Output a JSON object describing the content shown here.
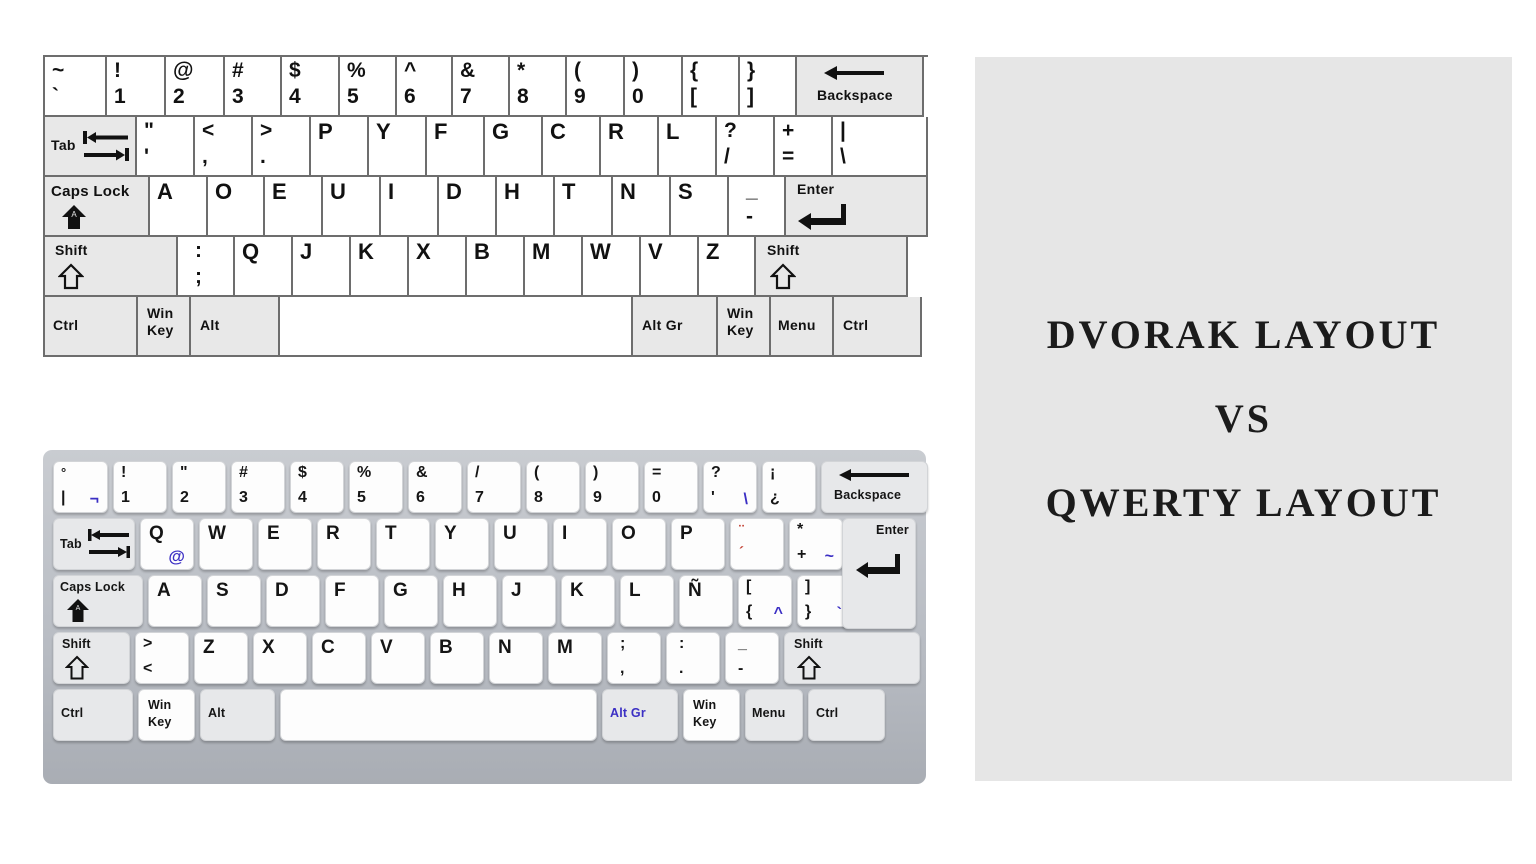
{
  "title": {
    "line1": "DVORAK LAYOUT",
    "line2": "VS",
    "line3": "QWERTY LAYOUT",
    "panel_bg": "#e6e6e6",
    "text_color": "#1b1b1b"
  },
  "dvorak": {
    "name": "Dvorak keyboard layout diagram",
    "style": "flat outline, white keys, grey modifier keys",
    "rows": [
      {
        "id": "number-row",
        "keys": [
          {
            "top": "~",
            "bottom": "`"
          },
          {
            "top": "!",
            "bottom": "1"
          },
          {
            "top": "@",
            "bottom": "2"
          },
          {
            "top": "#",
            "bottom": "3"
          },
          {
            "top": "$",
            "bottom": "4"
          },
          {
            "top": "%",
            "bottom": "5"
          },
          {
            "top": "^",
            "bottom": "6"
          },
          {
            "top": "&",
            "bottom": "7"
          },
          {
            "top": "*",
            "bottom": "8"
          },
          {
            "top": "(",
            "bottom": "9"
          },
          {
            "top": ")",
            "bottom": "0"
          },
          {
            "top": "{",
            "bottom": "["
          },
          {
            "top": "}",
            "bottom": "]"
          },
          {
            "name": "Backspace",
            "mod": true,
            "icon": "arrow-left"
          }
        ]
      },
      {
        "id": "top-row",
        "keys": [
          {
            "name": "Tab",
            "mod": true,
            "icon": "tab-arrows"
          },
          {
            "top": "\"",
            "bottom": "'"
          },
          {
            "top": "<",
            "bottom": ","
          },
          {
            "top": ">",
            "bottom": "."
          },
          {
            "single": "P"
          },
          {
            "single": "Y"
          },
          {
            "single": "F"
          },
          {
            "single": "G"
          },
          {
            "single": "C"
          },
          {
            "single": "R"
          },
          {
            "single": "L"
          },
          {
            "top": "?",
            "bottom": "/"
          },
          {
            "top": "+",
            "bottom": "="
          },
          {
            "top": "|",
            "bottom": "\\"
          }
        ]
      },
      {
        "id": "home-row",
        "keys": [
          {
            "name": "Caps Lock",
            "mod": true,
            "icon": "caps-arrow"
          },
          {
            "single": "A"
          },
          {
            "single": "O"
          },
          {
            "single": "E"
          },
          {
            "single": "U"
          },
          {
            "single": "I"
          },
          {
            "single": "D"
          },
          {
            "single": "H"
          },
          {
            "single": "T"
          },
          {
            "single": "N"
          },
          {
            "single": "S"
          },
          {
            "top": "_",
            "bottom": "-"
          },
          {
            "name": "Enter",
            "mod": true,
            "icon": "enter-arrow"
          }
        ]
      },
      {
        "id": "bottom-letter-row",
        "keys": [
          {
            "name": "Shift",
            "mod": true,
            "icon": "shift-arrow"
          },
          {
            "top": ":",
            "bottom": ";"
          },
          {
            "single": "Q"
          },
          {
            "single": "J"
          },
          {
            "single": "K"
          },
          {
            "single": "X"
          },
          {
            "single": "B"
          },
          {
            "single": "M"
          },
          {
            "single": "W"
          },
          {
            "single": "V"
          },
          {
            "single": "Z"
          },
          {
            "name": "Shift",
            "mod": true,
            "icon": "shift-arrow"
          }
        ]
      },
      {
        "id": "modifier-row",
        "keys": [
          {
            "name": "Ctrl",
            "mod": true
          },
          {
            "name": "Win Key",
            "mod": true,
            "two_line": true
          },
          {
            "name": "Alt",
            "mod": true
          },
          {
            "name": "",
            "space": true
          },
          {
            "name": "Alt Gr",
            "mod": true
          },
          {
            "name": "Win Key",
            "mod": true,
            "two_line": true
          },
          {
            "name": "Menu",
            "mod": true
          },
          {
            "name": "Ctrl",
            "mod": true
          }
        ]
      }
    ]
  },
  "qwerty": {
    "name": "Spanish QWERTY keyboard layout photo",
    "style": "3D keycaps on grey chassis",
    "accent_color": "#3b2fc4",
    "dead_key_color": "#c0392b",
    "rows": [
      {
        "id": "number-row",
        "keys": [
          {
            "tl": "°",
            "bl": "|",
            "br": "¬"
          },
          {
            "tl": "!",
            "bl": "1"
          },
          {
            "tl": "\"",
            "bl": "2"
          },
          {
            "tl": "#",
            "bl": "3"
          },
          {
            "tl": "$",
            "bl": "4"
          },
          {
            "tl": "%",
            "bl": "5"
          },
          {
            "tl": "&",
            "bl": "6"
          },
          {
            "tl": "/",
            "bl": "7"
          },
          {
            "tl": "(",
            "bl": "8"
          },
          {
            "tl": ")",
            "bl": "9"
          },
          {
            "tl": "=",
            "bl": "0"
          },
          {
            "tl": "?",
            "bl": "'",
            "br": "\\"
          },
          {
            "tl": "¡",
            "bl": "¿"
          },
          {
            "name": "Backspace",
            "mod": true,
            "icon": "arrow-left"
          }
        ]
      },
      {
        "id": "top-row",
        "keys": [
          {
            "name": "Tab",
            "mod": true,
            "icon": "tab-arrows"
          },
          {
            "ctr": "Q",
            "br": "@"
          },
          {
            "ctr": "W"
          },
          {
            "ctr": "E"
          },
          {
            "ctr": "R"
          },
          {
            "ctr": "T"
          },
          {
            "ctr": "Y"
          },
          {
            "ctr": "U"
          },
          {
            "ctr": "I"
          },
          {
            "ctr": "O"
          },
          {
            "ctr": "P"
          },
          {
            "dead_tl": "¨",
            "dead_bl": "´"
          },
          {
            "tl": "*",
            "bl": "+",
            "br": "~"
          }
        ]
      },
      {
        "id": "home-row",
        "keys": [
          {
            "name": "Caps Lock",
            "mod": true,
            "icon": "caps-arrow"
          },
          {
            "ctr": "A"
          },
          {
            "ctr": "S"
          },
          {
            "ctr": "D"
          },
          {
            "ctr": "F"
          },
          {
            "ctr": "G"
          },
          {
            "ctr": "H"
          },
          {
            "ctr": "J"
          },
          {
            "ctr": "K"
          },
          {
            "ctr": "L"
          },
          {
            "ctr": "Ñ"
          },
          {
            "tl": "[",
            "bl": "{",
            "br": "^"
          },
          {
            "tl": "]",
            "bl": "}",
            "br": "`"
          }
        ]
      },
      {
        "id": "bottom-letter-row",
        "keys": [
          {
            "name": "Shift",
            "mod": true,
            "icon": "shift-arrow"
          },
          {
            "tl": ">",
            "bl": "<"
          },
          {
            "ctr": "Z"
          },
          {
            "ctr": "X"
          },
          {
            "ctr": "C"
          },
          {
            "ctr": "V"
          },
          {
            "ctr": "B"
          },
          {
            "ctr": "N"
          },
          {
            "ctr": "M"
          },
          {
            "tl": ";",
            "bl": ","
          },
          {
            "tl": ":",
            "bl": "."
          },
          {
            "tl": "_",
            "bl": "-"
          },
          {
            "name": "Shift",
            "mod": true,
            "icon": "shift-arrow"
          }
        ]
      },
      {
        "id": "modifier-row",
        "keys": [
          {
            "name": "Ctrl",
            "mod": true
          },
          {
            "name": "Win Key",
            "mod": true,
            "two_line": true
          },
          {
            "name": "Alt",
            "mod": true
          },
          {
            "name": "",
            "space": true
          },
          {
            "name": "Alt Gr",
            "mod": true,
            "blue": true
          },
          {
            "name": "Win Key",
            "mod": true,
            "two_line": true
          },
          {
            "name": "Menu",
            "mod": true
          },
          {
            "name": "Ctrl",
            "mod": true
          }
        ]
      }
    ]
  }
}
